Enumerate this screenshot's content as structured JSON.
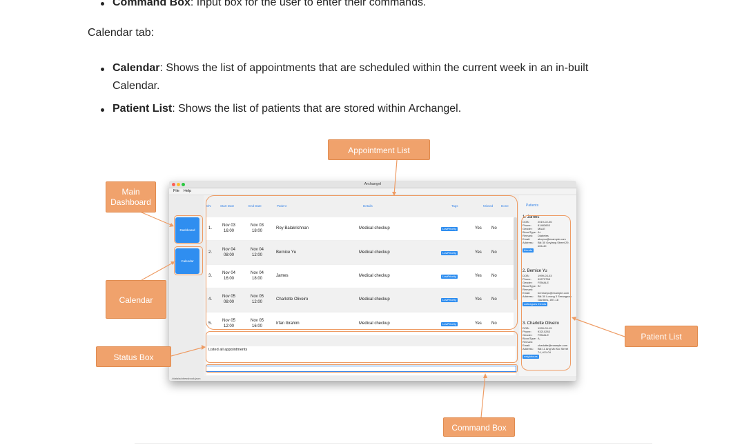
{
  "doc": {
    "command_box_term": "Command Box",
    "command_box_desc": ": Input box for the user to enter their commands.",
    "calendar_tab_heading": "Calendar tab:",
    "calendar_term": "Calendar",
    "calendar_desc_1": ": Shows the list of appointments that are scheduled within the current week in an in-built",
    "calendar_desc_2": "Calendar.",
    "patient_list_term": "Patient List",
    "patient_list_desc": ": Shows the list of patients that are stored within Archangel."
  },
  "app": {
    "window_title": "Archangel",
    "menu": [
      "File",
      "Help"
    ],
    "nav": {
      "dashboard": "Dashboard",
      "calendar": "Calendar"
    },
    "columns": [
      "S/N",
      "Start Date",
      "End Date",
      "Patient",
      "Details",
      "Tags",
      "Missed",
      "Done"
    ],
    "rows": [
      {
        "sn": "1.",
        "start_date": "Nov 03",
        "start_time": "16:00",
        "end_date": "Nov 03",
        "end_time": "18:00",
        "patient": "Roy Balakrishnan",
        "details": "Medical checkup",
        "tag": "LowPriority",
        "missed": "Yes",
        "done": "No"
      },
      {
        "sn": "2.",
        "start_date": "Nov 04",
        "start_time": "08:00",
        "end_date": "Nov 04",
        "end_time": "12:00",
        "patient": "Bernice Yu",
        "details": "Medical checkup",
        "tag": "LowPriority",
        "missed": "Yes",
        "done": "No"
      },
      {
        "sn": "3.",
        "start_date": "Nov 04",
        "start_time": "16:00",
        "end_date": "Nov 04",
        "end_time": "18:00",
        "patient": "James",
        "details": "Medical checkup",
        "tag": "LowPriority",
        "missed": "Yes",
        "done": "No"
      },
      {
        "sn": "4.",
        "start_date": "Nov 05",
        "start_time": "08:00",
        "end_date": "Nov 05",
        "end_time": "12:00",
        "patient": "Charlotte Oliveiro",
        "details": "Medical checkup",
        "tag": "LowPriority",
        "missed": "Yes",
        "done": "No"
      },
      {
        "sn": "5.",
        "start_date": "Nov 05",
        "start_time": "12:00",
        "end_date": "Nov 05",
        "end_time": "16:00",
        "patient": "Irfan Ibrahim",
        "details": "Medical checkup",
        "tag": "LowPriority",
        "missed": "Yes",
        "done": "No"
      }
    ],
    "status_text": "Listed all appointments",
    "footer_path": "./data/addressbook.json",
    "patients_header": "Patients",
    "patients": [
      {
        "name": "1. James",
        "dob": "2019-02-06",
        "phone": "81483653",
        "gender": "MALE",
        "blood": "A+",
        "remark": "Diabetes",
        "email": "abcyou@example.com",
        "address": "Blk 30 Geylang Street 29, #06-40",
        "tag": "friends"
      },
      {
        "name": "2. Bernice Yu",
        "dob": "1999-03-03",
        "phone": "99272758",
        "gender": "FEMALE",
        "blood": "B+",
        "remark": "",
        "email": "berniceyu@example.com",
        "address": "Blk 30 Lorong 3 Serangoon Gardens, #07-18",
        "tag": "colleagues friends"
      },
      {
        "name": "3. Charlotte Oliveiro",
        "dob": "1999-09-15",
        "phone": "93210283",
        "gender": "FEMALE",
        "blood": "A-",
        "remark": "",
        "email": "charlotte@example.com",
        "address": "Blk 11 Ang Mo Kio Street 74, #11-04",
        "tag": "neighbours"
      }
    ],
    "field_labels": {
      "dob": "DOB:",
      "phone": "Phone:",
      "gender": "Gender:",
      "blood": "BloodType:",
      "remark": "Remark:",
      "email": "Email:",
      "address": "Address:"
    }
  },
  "callouts": {
    "appointment_list": "Appointment List",
    "main_dashboard_1": "Main",
    "main_dashboard_2": "Dashboard",
    "calendar": "Calendar",
    "status_box": "Status Box",
    "patient_list": "Patient List",
    "command_box": "Command Box"
  },
  "colors": {
    "callout": "#f0a26c",
    "accent": "#2f8ef0"
  }
}
